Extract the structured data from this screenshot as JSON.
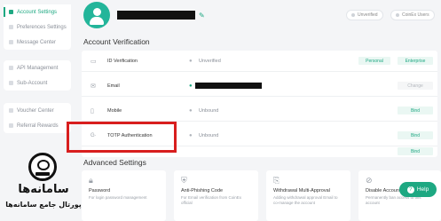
{
  "sidebar": {
    "group1": [
      {
        "label": "Account Settings",
        "active": true
      },
      {
        "label": "Preferences Settings",
        "active": false
      },
      {
        "label": "Message Center",
        "active": false
      }
    ],
    "group2": [
      {
        "label": "API Management"
      },
      {
        "label": "Sub-Account"
      }
    ],
    "group3": [
      {
        "label": "Voucher Center"
      },
      {
        "label": "Referral Rewards"
      }
    ]
  },
  "profile": {
    "status_unverified": "Unverified",
    "status_users": "CoinEx Users"
  },
  "account_verification": {
    "title": "Account Verification",
    "rows": [
      {
        "icon": "id-card-icon",
        "label": "ID Verification",
        "status": "Unverified",
        "actions": [
          "Personal",
          "Enterprise"
        ]
      },
      {
        "icon": "email-icon",
        "label": "Email",
        "status": "",
        "actions": [
          "Change"
        ]
      },
      {
        "icon": "mobile-icon",
        "label": "Mobile",
        "status": "Unbound",
        "actions": [
          "Bind"
        ]
      },
      {
        "icon": "google-authenticator-icon",
        "label": "TOTP Authentication",
        "status": "Unbound",
        "actions": [
          "Bind"
        ]
      }
    ],
    "extra_row_action": "Bind"
  },
  "advanced_settings": {
    "title": "Advanced Settings",
    "cards": [
      {
        "icon": "lock-icon",
        "title": "Password",
        "desc": "For login password management"
      },
      {
        "icon": "shield-icon",
        "title": "Anti-Phishing Code",
        "desc": "For Email verification from CoinEx official"
      },
      {
        "icon": "withdraw-icon",
        "title": "Withdrawal Multi-Approval",
        "desc": "Adding withdrawal approval Email to co-manage the account"
      },
      {
        "icon": "disable-icon",
        "title": "Disable Account",
        "desc": "Permanently ban access to this account"
      }
    ]
  },
  "help_button": {
    "label": "Help"
  },
  "watermark": {
    "line1": "سامانه‌ها",
    "line2": "پورتال جامع سامانه‌ها"
  },
  "colors": {
    "accent": "#1ea882",
    "highlight": "#d81e1e"
  }
}
